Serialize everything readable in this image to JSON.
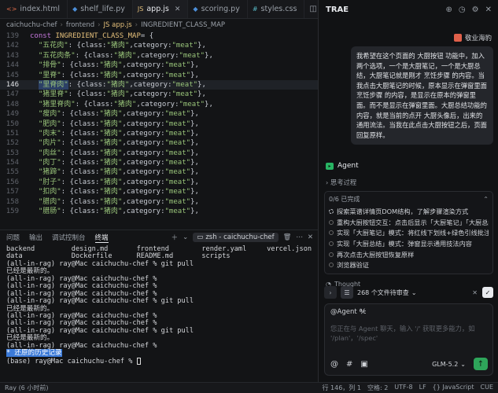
{
  "editor": {
    "tabs": [
      {
        "icon": "html-icon",
        "label": "index.html",
        "active": false
      },
      {
        "icon": "python-icon",
        "label": "shelf_life.py",
        "active": false
      },
      {
        "icon": "js-icon",
        "label": "app.js",
        "active": true
      },
      {
        "icon": "python-icon",
        "label": "scoring.py",
        "active": false
      },
      {
        "icon": "css-icon",
        "label": "styles.css",
        "active": false
      }
    ],
    "breadcrumb": [
      "caichuchu-chef",
      "frontend",
      "JS app.js",
      "INGREDIENT_CLASS_MAP"
    ],
    "decl": {
      "ln": "139",
      "kw": "const",
      "name": "INGREDIENT_CLASS_MAP",
      "rest": " = {"
    },
    "rows": [
      {
        "ln": "142",
        "key": "\"五花肉\"",
        "cls": "猪肉",
        "cat": "meat",
        "cur": false
      },
      {
        "ln": "143",
        "key": "\"五花肉条\"",
        "cls": "猪肉",
        "cat": "meat",
        "cur": false
      },
      {
        "ln": "144",
        "key": "\"排骨\"",
        "cls": "猪肉",
        "cat": "meat",
        "cur": false
      },
      {
        "ln": "145",
        "key": "\"里脊\"",
        "cls": "猪肉",
        "cat": "meat",
        "cur": false
      },
      {
        "ln": "146",
        "key": "\"里脊肉\"",
        "cls": "猪肉",
        "cat": "meat",
        "cur": true
      },
      {
        "ln": "147",
        "key": "\"猪里脊\"",
        "cls": "猪肉",
        "cat": "meat",
        "cur": false
      },
      {
        "ln": "148",
        "key": "\"猪里脊肉\"",
        "cls": "猪肉",
        "cat": "meat",
        "cur": false
      },
      {
        "ln": "149",
        "key": "\"瘦肉\"",
        "cls": "猪肉",
        "cat": "meat",
        "cur": false
      },
      {
        "ln": "150",
        "key": "\"肥肉\"",
        "cls": "猪肉",
        "cat": "meat",
        "cur": false
      },
      {
        "ln": "151",
        "key": "\"肉末\"",
        "cls": "猪肉",
        "cat": "meat",
        "cur": false
      },
      {
        "ln": "152",
        "key": "\"肉片\"",
        "cls": "猪肉",
        "cat": "meat",
        "cur": false
      },
      {
        "ln": "153",
        "key": "\"肉丝\"",
        "cls": "猪肉",
        "cat": "meat",
        "cur": false
      },
      {
        "ln": "154",
        "key": "\"肉丁\"",
        "cls": "猪肉",
        "cat": "meat",
        "cur": false
      },
      {
        "ln": "155",
        "key": "\"猪蹄\"",
        "cls": "猪肉",
        "cat": "meat",
        "cur": false
      },
      {
        "ln": "156",
        "key": "\"肘子\"",
        "cls": "猪肉",
        "cat": "meat",
        "cur": false
      },
      {
        "ln": "157",
        "key": "\"扣肉\"",
        "cls": "猪肉",
        "cat": "meat",
        "cur": false
      },
      {
        "ln": "158",
        "key": "\"腊肉\"",
        "cls": "猪肉",
        "cat": "meat",
        "cur": false
      },
      {
        "ln": "159",
        "key": "\"腊肠\"",
        "cls": "猪肉",
        "cat": "meat",
        "cur": false
      }
    ],
    "code_tokens": {
      "class_word": "class",
      "category_word": "category"
    }
  },
  "panel": {
    "tabs": [
      "问题",
      "输出",
      "调试控制台",
      "终端"
    ],
    "active_tab": "终端",
    "terminal_name": "zsh - caichuchu-chef",
    "lines": [
      "backend         design.md       frontend        render.yaml     vercel.json",
      "data            Dockerfile      README.md       scripts",
      "(all-in-rag) ray@Mac caichuchu-chef % git pull",
      "已经是最新的。",
      "(all-in-rag) ray@Mac caichuchu-chef %",
      "(all-in-rag) ray@Mac caichuchu-chef %",
      "(all-in-rag) ray@Mac caichuchu-chef %",
      "(all-in-rag) ray@Mac caichuchu-chef % git pull",
      "已经是最新的。",
      "(all-in-rag) ray@Mac caichuchu-chef %",
      "(all-in-rag) ray@Mac caichuchu-chef %",
      "(all-in-rag) ray@Mac caichuchu-chef % git pull",
      "已经是最新的。",
      "(all-in-rag) ray@Mac caichuchu-chef %"
    ],
    "restored": "* 还原的历史记录",
    "prompt": "(base) ray@Mac caichuchu-chef % "
  },
  "status": {
    "left": [
      "Ray (6 小时前)"
    ],
    "right": [
      "行 146，列 1",
      "空格: 2",
      "UTF-8",
      "LF",
      "{} JavaScript",
      "CUE"
    ]
  },
  "agent": {
    "title": "TRAE",
    "user_name": "敬业海豹",
    "message": "我希望在这个页面的 大厨按钮 功能中，加入两个选项，一个是大厨笔记，一个是大厨总结，大厨笔记就是刚才 烹饪步骤 的内容。当我点击大厨笔记的时候，原本显示在弹窗里面 烹饪步骤 的内容，是显示在原本的弹窗里面。而不是显示在弹窗里面。大厨总结功能的内容，就是当前的点开 大厨头像后，出来的通用流法。当我在此点击大厨按钮之后，页面回复原样。",
    "agent_label": "Agent",
    "thinking": "思考过程",
    "todo_head": "0/6 已完成",
    "todos": [
      {
        "label": "探索菜谱详情页DOM结构，了解步骤渲染方式",
        "state": "in-progress"
      },
      {
        "label": "重构大厨按钮交互：点击后显示「大厨笔记」「大厨总结」",
        "state": "pending"
      },
      {
        "label": "实现「大厨笔记」模式：将红线下划线+绿色引线批注直接",
        "state": "pending"
      },
      {
        "label": "实现「大厨总结」模式：弹窗显示通用技法内容",
        "state": "pending"
      },
      {
        "label": "再次点击大厨按钮恢复原样",
        "state": "pending"
      },
      {
        "label": "浏览器验证",
        "state": "pending"
      }
    ],
    "thought": "Thought",
    "files": "268 个文件待审查",
    "mention": "@Agent",
    "placeholder": "您正在与 Agent 聊天，输入 '/' 获取更多能力，如 '/plan'，'/spec'",
    "model": "GLM-5.2"
  }
}
